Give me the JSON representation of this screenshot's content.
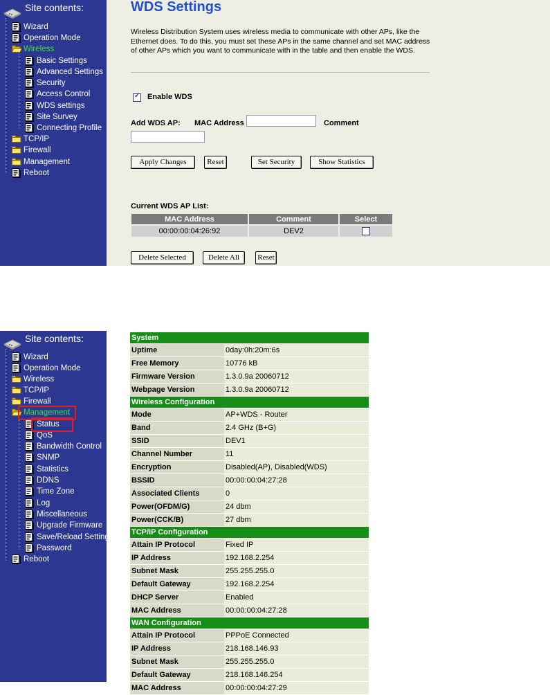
{
  "sidebar_header": "Site contents:",
  "screen1": {
    "nav": [
      {
        "label": "Wizard",
        "icon": "page-icon"
      },
      {
        "label": "Operation Mode",
        "icon": "page-icon"
      },
      {
        "label": "Wireless",
        "icon": "folder-open-icon",
        "active": true
      },
      {
        "label": "Basic Settings",
        "icon": "page-icon"
      },
      {
        "label": "Advanced Settings",
        "icon": "page-icon"
      },
      {
        "label": "Security",
        "icon": "page-icon"
      },
      {
        "label": "Access Control",
        "icon": "page-icon"
      },
      {
        "label": "WDS settings",
        "icon": "page-icon"
      },
      {
        "label": "Site Survey",
        "icon": "page-icon"
      },
      {
        "label": "Connecting Profile",
        "icon": "page-icon"
      },
      {
        "label": "TCP/IP",
        "icon": "folder-icon"
      },
      {
        "label": "Firewall",
        "icon": "folder-icon"
      },
      {
        "label": "Management",
        "icon": "folder-icon"
      },
      {
        "label": "Reboot",
        "icon": "page-icon"
      }
    ],
    "title": "WDS Settings",
    "description": "Wireless Distribution System uses wireless media to communicate with other APs, like the Ethernet does. To do this, you must set these APs in the same channel and set MAC address of other APs which you want to communicate with in the table and then enable the WDS.",
    "enable_wds_label": "Enable WDS",
    "enable_wds_checked": true,
    "add_wds_ap_label": "Add WDS AP:",
    "mac_address_label": "MAC Address",
    "comment_label": "Comment",
    "mac_value": "",
    "comment_value": "",
    "buttons": {
      "apply": "Apply Changes",
      "reset": "Reset",
      "set_security": "Set Security",
      "show_statistics": "Show Statistics"
    },
    "list_title": "Current WDS AP List:",
    "list_headers": [
      "MAC Address",
      "Comment",
      "Select"
    ],
    "list_rows": [
      {
        "mac": "00:00:00:04:26:92",
        "comment": "DEV2",
        "selected": false
      }
    ],
    "list_buttons": {
      "delete_selected": "Delete Selected",
      "delete_all": "Delete All",
      "reset": "Reset"
    }
  },
  "screen2": {
    "nav": [
      {
        "label": "Wizard",
        "icon": "page-icon"
      },
      {
        "label": "Operation Mode",
        "icon": "page-icon"
      },
      {
        "label": "Wireless",
        "icon": "folder-icon"
      },
      {
        "label": "TCP/IP",
        "icon": "folder-icon"
      },
      {
        "label": "Firewall",
        "icon": "folder-icon"
      },
      {
        "label": "Management",
        "icon": "folder-open-icon",
        "active": true
      },
      {
        "label": "Status",
        "icon": "page-icon"
      },
      {
        "label": "QoS",
        "icon": "page-icon"
      },
      {
        "label": "Bandwidth Control",
        "icon": "page-icon"
      },
      {
        "label": "SNMP",
        "icon": "page-icon"
      },
      {
        "label": "Statistics",
        "icon": "page-icon"
      },
      {
        "label": "DDNS",
        "icon": "page-icon"
      },
      {
        "label": "Time Zone",
        "icon": "page-icon"
      },
      {
        "label": "Log",
        "icon": "page-icon"
      },
      {
        "label": "Miscellaneous",
        "icon": "page-icon"
      },
      {
        "label": "Upgrade Firmware",
        "icon": "page-icon"
      },
      {
        "label": "Save/Reload Settings",
        "icon": "page-icon"
      },
      {
        "label": "Password",
        "icon": "page-icon"
      },
      {
        "label": "Reboot",
        "icon": "page-icon"
      }
    ],
    "highlight_color": "#e0201e",
    "sections": [
      {
        "title": "System",
        "rows": [
          [
            "Uptime",
            "0day:0h:20m:6s"
          ],
          [
            "Free Memory",
            "10776 kB"
          ],
          [
            "Firmware Version",
            "1.3.0.9a 20060712"
          ],
          [
            "Webpage Version",
            "1.3.0.9a 20060712"
          ]
        ]
      },
      {
        "title": "Wireless Configuration",
        "rows": [
          [
            "Mode",
            "AP+WDS - Router"
          ],
          [
            "Band",
            "2.4 GHz (B+G)"
          ],
          [
            "SSID",
            "DEV1"
          ],
          [
            "Channel Number",
            "11"
          ],
          [
            "Encryption",
            "Disabled(AP), Disabled(WDS)"
          ],
          [
            "BSSID",
            "00:00:00:04:27:28"
          ],
          [
            "Associated Clients",
            "0"
          ],
          [
            "Power(OFDM/G)",
            "24 dbm"
          ],
          [
            "Power(CCK/B)",
            "27 dbm"
          ]
        ]
      },
      {
        "title": "TCP/IP Configuration",
        "rows": [
          [
            "Attain IP Protocol",
            "Fixed IP"
          ],
          [
            "IP Address",
            "192.168.2.254"
          ],
          [
            "Subnet Mask",
            "255.255.255.0"
          ],
          [
            "Default Gateway",
            "192.168.2.254"
          ],
          [
            "DHCP Server",
            "Enabled"
          ],
          [
            "MAC Address",
            "00:00:00:04:27:28"
          ]
        ]
      },
      {
        "title": "WAN Configuration",
        "rows": [
          [
            "Attain IP Protocol",
            "PPPoE Connected"
          ],
          [
            "IP Address",
            "218.168.146.93"
          ],
          [
            "Subnet Mask",
            "255.255.255.0"
          ],
          [
            "Default Gateway",
            "218.168.146.254"
          ],
          [
            "MAC Address",
            "00:00:00:04:27:29"
          ]
        ]
      }
    ]
  }
}
